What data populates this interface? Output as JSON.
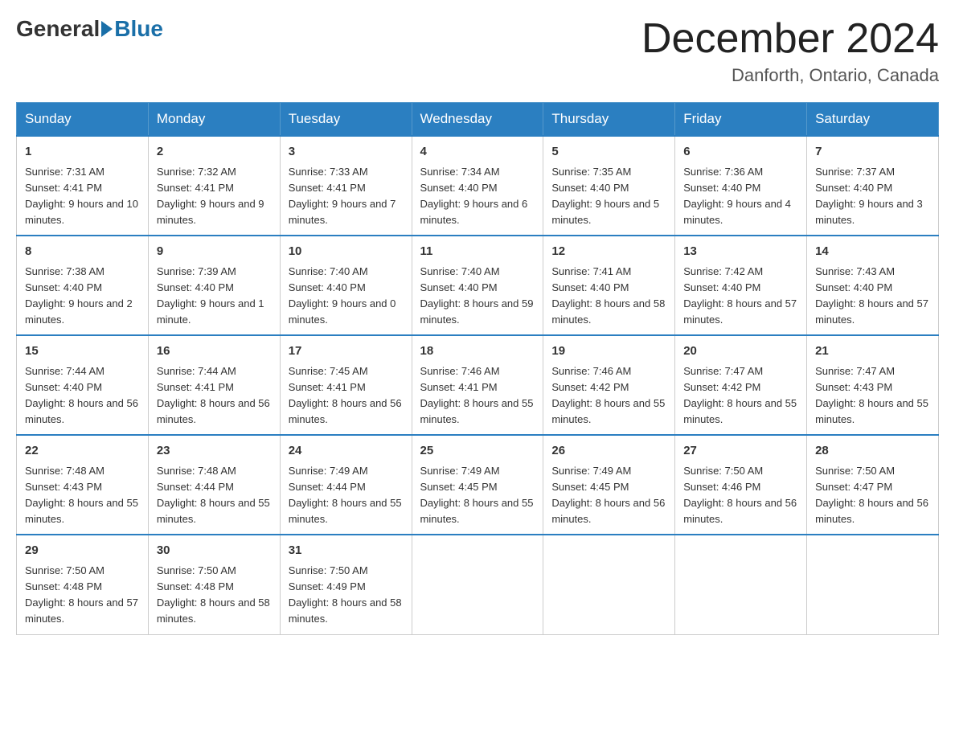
{
  "header": {
    "logo_general": "General",
    "logo_blue": "Blue",
    "month_title": "December 2024",
    "location": "Danforth, Ontario, Canada"
  },
  "days_of_week": [
    "Sunday",
    "Monday",
    "Tuesday",
    "Wednesday",
    "Thursday",
    "Friday",
    "Saturday"
  ],
  "weeks": [
    [
      {
        "day": "1",
        "sunrise": "7:31 AM",
        "sunset": "4:41 PM",
        "daylight": "9 hours and 10 minutes."
      },
      {
        "day": "2",
        "sunrise": "7:32 AM",
        "sunset": "4:41 PM",
        "daylight": "9 hours and 9 minutes."
      },
      {
        "day": "3",
        "sunrise": "7:33 AM",
        "sunset": "4:41 PM",
        "daylight": "9 hours and 7 minutes."
      },
      {
        "day": "4",
        "sunrise": "7:34 AM",
        "sunset": "4:40 PM",
        "daylight": "9 hours and 6 minutes."
      },
      {
        "day": "5",
        "sunrise": "7:35 AM",
        "sunset": "4:40 PM",
        "daylight": "9 hours and 5 minutes."
      },
      {
        "day": "6",
        "sunrise": "7:36 AM",
        "sunset": "4:40 PM",
        "daylight": "9 hours and 4 minutes."
      },
      {
        "day": "7",
        "sunrise": "7:37 AM",
        "sunset": "4:40 PM",
        "daylight": "9 hours and 3 minutes."
      }
    ],
    [
      {
        "day": "8",
        "sunrise": "7:38 AM",
        "sunset": "4:40 PM",
        "daylight": "9 hours and 2 minutes."
      },
      {
        "day": "9",
        "sunrise": "7:39 AM",
        "sunset": "4:40 PM",
        "daylight": "9 hours and 1 minute."
      },
      {
        "day": "10",
        "sunrise": "7:40 AM",
        "sunset": "4:40 PM",
        "daylight": "9 hours and 0 minutes."
      },
      {
        "day": "11",
        "sunrise": "7:40 AM",
        "sunset": "4:40 PM",
        "daylight": "8 hours and 59 minutes."
      },
      {
        "day": "12",
        "sunrise": "7:41 AM",
        "sunset": "4:40 PM",
        "daylight": "8 hours and 58 minutes."
      },
      {
        "day": "13",
        "sunrise": "7:42 AM",
        "sunset": "4:40 PM",
        "daylight": "8 hours and 57 minutes."
      },
      {
        "day": "14",
        "sunrise": "7:43 AM",
        "sunset": "4:40 PM",
        "daylight": "8 hours and 57 minutes."
      }
    ],
    [
      {
        "day": "15",
        "sunrise": "7:44 AM",
        "sunset": "4:40 PM",
        "daylight": "8 hours and 56 minutes."
      },
      {
        "day": "16",
        "sunrise": "7:44 AM",
        "sunset": "4:41 PM",
        "daylight": "8 hours and 56 minutes."
      },
      {
        "day": "17",
        "sunrise": "7:45 AM",
        "sunset": "4:41 PM",
        "daylight": "8 hours and 56 minutes."
      },
      {
        "day": "18",
        "sunrise": "7:46 AM",
        "sunset": "4:41 PM",
        "daylight": "8 hours and 55 minutes."
      },
      {
        "day": "19",
        "sunrise": "7:46 AM",
        "sunset": "4:42 PM",
        "daylight": "8 hours and 55 minutes."
      },
      {
        "day": "20",
        "sunrise": "7:47 AM",
        "sunset": "4:42 PM",
        "daylight": "8 hours and 55 minutes."
      },
      {
        "day": "21",
        "sunrise": "7:47 AM",
        "sunset": "4:43 PM",
        "daylight": "8 hours and 55 minutes."
      }
    ],
    [
      {
        "day": "22",
        "sunrise": "7:48 AM",
        "sunset": "4:43 PM",
        "daylight": "8 hours and 55 minutes."
      },
      {
        "day": "23",
        "sunrise": "7:48 AM",
        "sunset": "4:44 PM",
        "daylight": "8 hours and 55 minutes."
      },
      {
        "day": "24",
        "sunrise": "7:49 AM",
        "sunset": "4:44 PM",
        "daylight": "8 hours and 55 minutes."
      },
      {
        "day": "25",
        "sunrise": "7:49 AM",
        "sunset": "4:45 PM",
        "daylight": "8 hours and 55 minutes."
      },
      {
        "day": "26",
        "sunrise": "7:49 AM",
        "sunset": "4:45 PM",
        "daylight": "8 hours and 56 minutes."
      },
      {
        "day": "27",
        "sunrise": "7:50 AM",
        "sunset": "4:46 PM",
        "daylight": "8 hours and 56 minutes."
      },
      {
        "day": "28",
        "sunrise": "7:50 AM",
        "sunset": "4:47 PM",
        "daylight": "8 hours and 56 minutes."
      }
    ],
    [
      {
        "day": "29",
        "sunrise": "7:50 AM",
        "sunset": "4:48 PM",
        "daylight": "8 hours and 57 minutes."
      },
      {
        "day": "30",
        "sunrise": "7:50 AM",
        "sunset": "4:48 PM",
        "daylight": "8 hours and 58 minutes."
      },
      {
        "day": "31",
        "sunrise": "7:50 AM",
        "sunset": "4:49 PM",
        "daylight": "8 hours and 58 minutes."
      },
      null,
      null,
      null,
      null
    ]
  ],
  "labels": {
    "sunrise": "Sunrise:",
    "sunset": "Sunset:",
    "daylight": "Daylight:"
  }
}
